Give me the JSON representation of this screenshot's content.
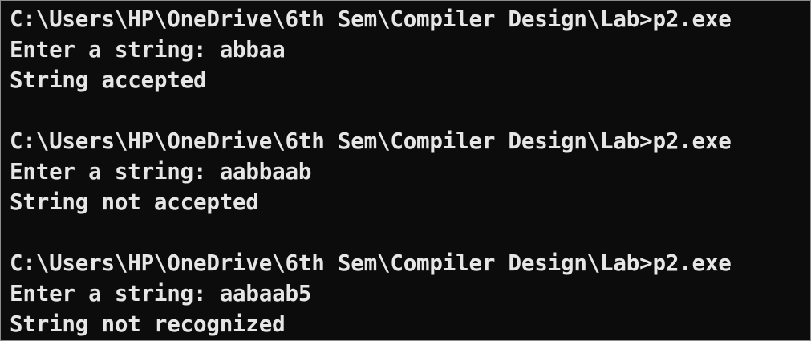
{
  "terminal": {
    "lines": [
      "C:\\Users\\HP\\OneDrive\\6th Sem\\Compiler Design\\Lab>p2.exe",
      "Enter a string: abbaa",
      "String accepted",
      "",
      "C:\\Users\\HP\\OneDrive\\6th Sem\\Compiler Design\\Lab>p2.exe",
      "Enter a string: aabbaab",
      "String not accepted",
      "",
      "C:\\Users\\HP\\OneDrive\\6th Sem\\Compiler Design\\Lab>p2.exe",
      "Enter a string: aabaab5",
      "String not recognized"
    ]
  },
  "colors": {
    "background": "#0c0c0c",
    "text": "#e6e6e6"
  }
}
